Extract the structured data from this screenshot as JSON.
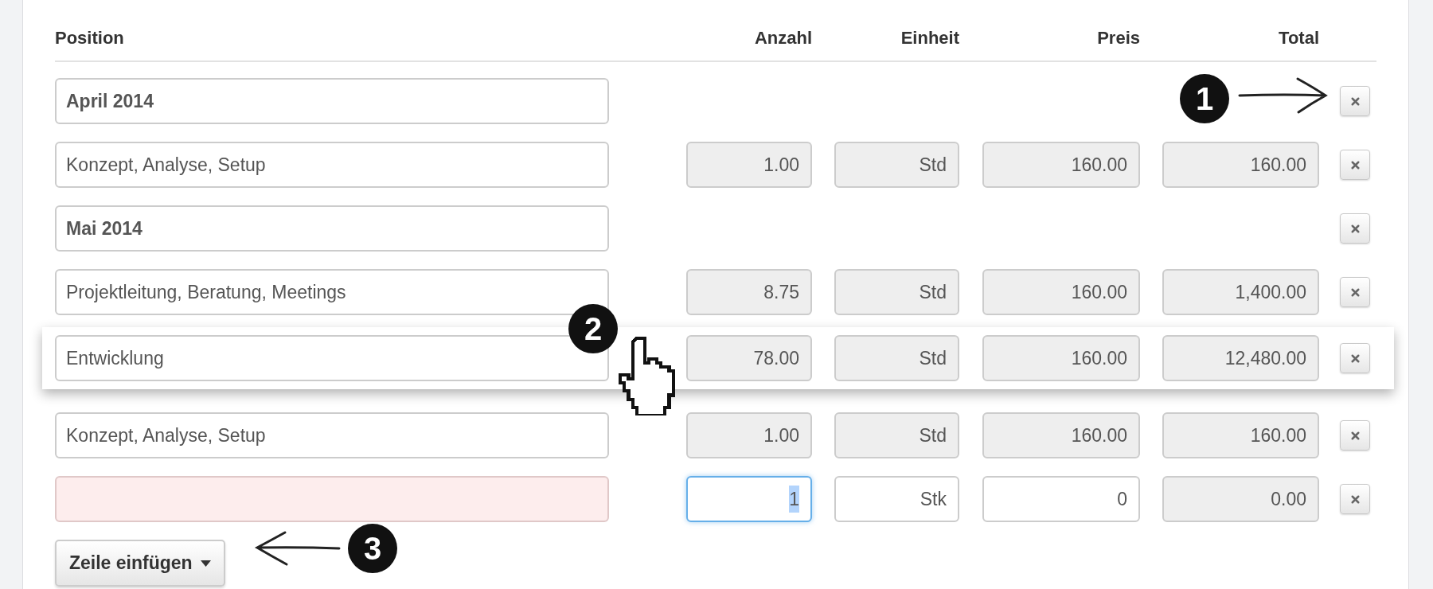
{
  "columns": [
    "Position",
    "Anzahl",
    "Einheit",
    "Preis",
    "Total"
  ],
  "rows": [
    {
      "kind": "section",
      "position": "April 2014",
      "dragging": false,
      "invalid": false
    },
    {
      "kind": "item",
      "position": "Konzept, Analyse, Setup",
      "dragging": false,
      "invalid": false,
      "cells": [
        {
          "value": "1.00",
          "editable": false,
          "focused": false
        },
        {
          "value": "Std",
          "editable": false,
          "focused": false
        },
        {
          "value": "160.00",
          "editable": false,
          "focused": false
        },
        {
          "value": "160.00",
          "editable": false,
          "focused": false
        }
      ]
    },
    {
      "kind": "section",
      "position": "Mai 2014",
      "dragging": false,
      "invalid": false
    },
    {
      "kind": "item",
      "position": "Projektleitung, Beratung, Meetings",
      "dragging": false,
      "invalid": false,
      "cells": [
        {
          "value": "8.75",
          "editable": false,
          "focused": false
        },
        {
          "value": "Std",
          "editable": false,
          "focused": false
        },
        {
          "value": "160.00",
          "editable": false,
          "focused": false
        },
        {
          "value": "1,400.00",
          "editable": false,
          "focused": false
        }
      ]
    },
    {
      "kind": "item",
      "position": "Entwicklung",
      "dragging": true,
      "invalid": false,
      "cells": [
        {
          "value": "78.00",
          "editable": false,
          "focused": false
        },
        {
          "value": "Std",
          "editable": false,
          "focused": false
        },
        {
          "value": "160.00",
          "editable": false,
          "focused": false
        },
        {
          "value": "12,480.00",
          "editable": false,
          "focused": false
        }
      ]
    },
    {
      "kind": "item",
      "position": "Konzept, Analyse, Setup",
      "dragging": false,
      "invalid": false,
      "cells": [
        {
          "value": "1.00",
          "editable": false,
          "focused": false
        },
        {
          "value": "Std",
          "editable": false,
          "focused": false
        },
        {
          "value": "160.00",
          "editable": false,
          "focused": false
        },
        {
          "value": "160.00",
          "editable": false,
          "focused": false
        }
      ]
    },
    {
      "kind": "item",
      "position": "",
      "dragging": false,
      "invalid": true,
      "cells": [
        {
          "value": "1",
          "editable": true,
          "focused": true
        },
        {
          "value": "Stk",
          "editable": true,
          "focused": false
        },
        {
          "value": "0",
          "editable": true,
          "focused": false
        },
        {
          "value": "0.00",
          "editable": false,
          "focused": false
        }
      ]
    }
  ],
  "add_button": {
    "label": "Zeile einfügen"
  },
  "annotations": [
    "1",
    "2",
    "3"
  ]
}
